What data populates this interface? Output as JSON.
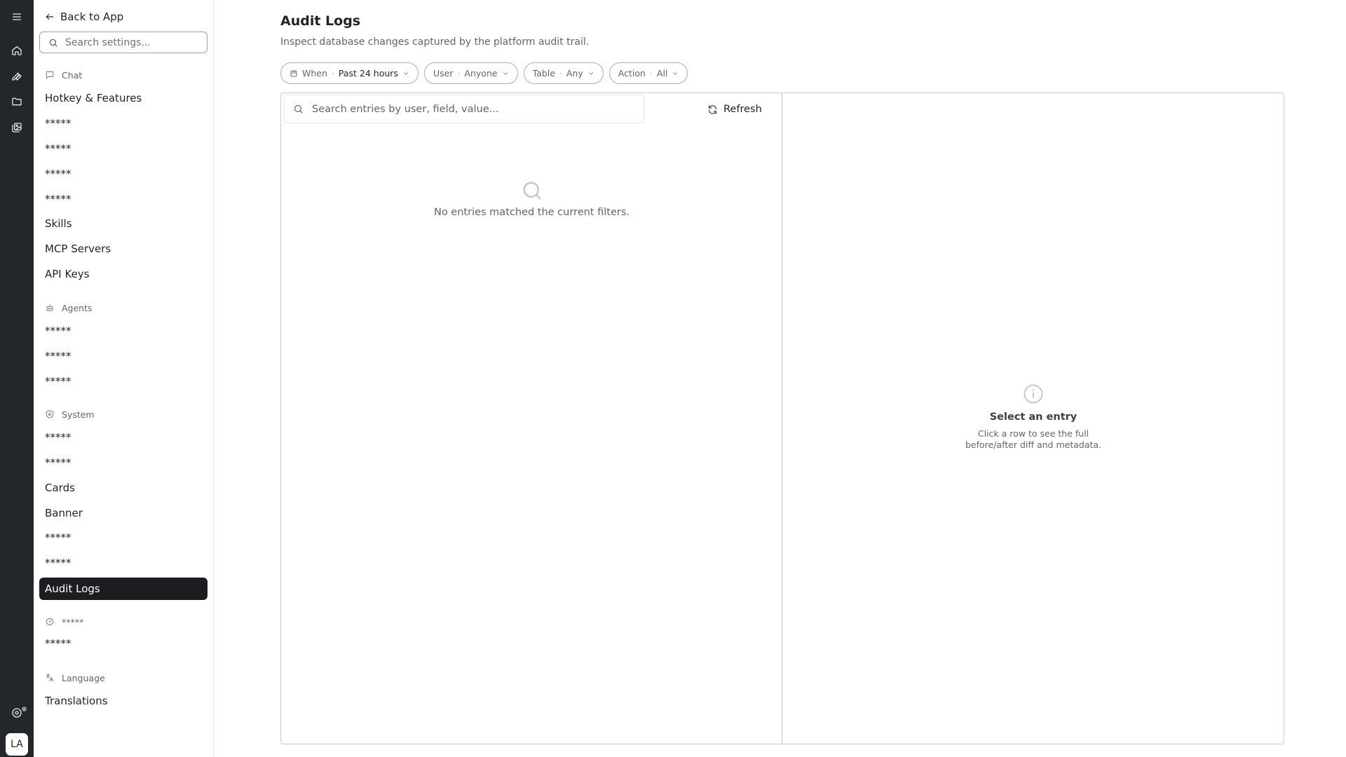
{
  "rail": {
    "icons": [
      "menu-icon",
      "home-icon",
      "wrench-icon",
      "folder-icon",
      "gallery-icon",
      "support-icon"
    ],
    "avatar_initials": "LA"
  },
  "sidebar": {
    "back_label": "Back to App",
    "search_placeholder": "Search settings...",
    "sections": [
      {
        "label": "Chat",
        "icon": "chat-icon"
      },
      {
        "label": "Agents",
        "icon": "robot-icon"
      },
      {
        "label": "System",
        "icon": "shield-icon"
      },
      {
        "label": "*****",
        "icon": "clock-icon"
      },
      {
        "label": "Language",
        "icon": "language-icon"
      }
    ],
    "items": [
      "Hotkey & Features",
      "*****",
      "*****",
      "*****",
      "*****",
      "Skills",
      "MCP Servers",
      "API Keys",
      "*****",
      "*****",
      "*****",
      "*****",
      "*****",
      "Cards",
      "Banner",
      "*****",
      "*****",
      "Audit Logs",
      "*****",
      "Translations"
    ],
    "active_item": "Audit Logs"
  },
  "main": {
    "title": "Audit Logs",
    "subtitle": "Inspect database changes captured by the platform audit trail.",
    "filters": [
      {
        "label": "When",
        "value": "Past 24 hours"
      },
      {
        "label": "User",
        "value": "Anyone"
      },
      {
        "label": "Table",
        "value": "Any"
      },
      {
        "label": "Action",
        "value": "All"
      }
    ],
    "search_placeholder": "Search entries by user, field, value...",
    "refresh_label": "Refresh",
    "empty_text": "No entries matched the current filters.",
    "detail": {
      "title": "Select an entry",
      "description_line1": "Click a row to see the full",
      "description_line2": "before/after diff and metadata."
    }
  }
}
